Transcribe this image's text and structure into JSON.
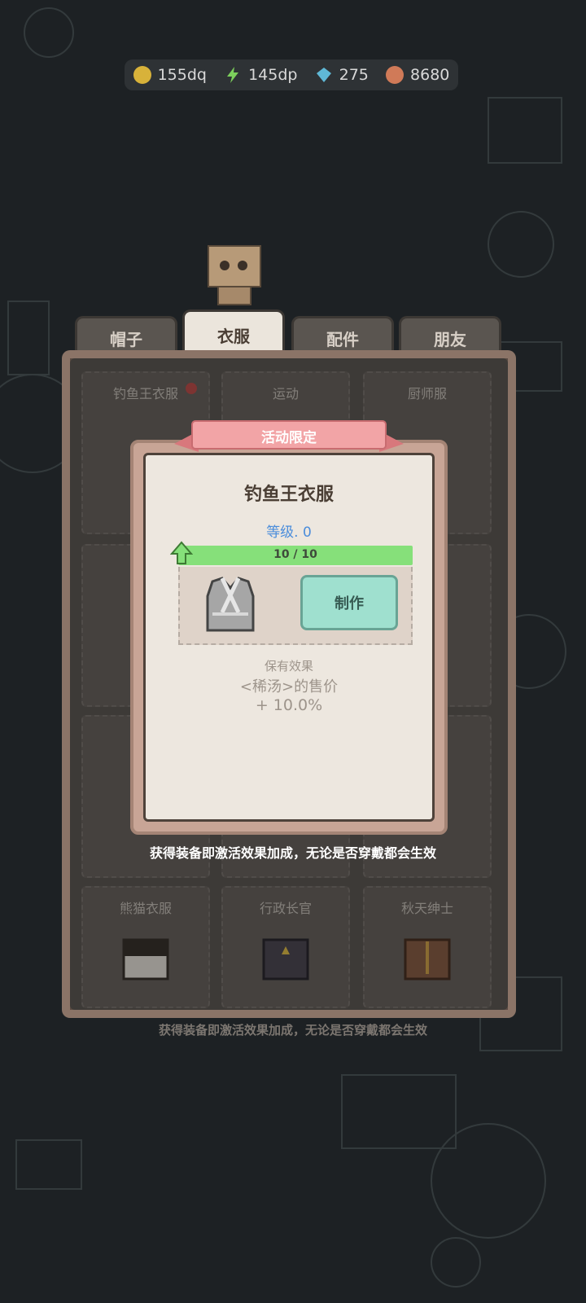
{
  "currencies": [
    {
      "icon": "gold-coin-icon",
      "value": "155dq",
      "color": "#d8b23a"
    },
    {
      "icon": "lightning-icon",
      "value": "145dp",
      "color": "#7ccf5c"
    },
    {
      "icon": "blue-gem-icon",
      "value": "275",
      "color": "#5fb8d6"
    },
    {
      "icon": "meat-icon",
      "value": "8680",
      "color": "#d07a58"
    }
  ],
  "tabs": [
    {
      "label": "帽子"
    },
    {
      "label": "衣服",
      "active": true
    },
    {
      "label": "配件"
    },
    {
      "label": "朋友"
    }
  ],
  "grid": {
    "items": [
      {
        "name": "钓鱼王衣服"
      },
      {
        "name": "运动"
      },
      {
        "name": "厨师服"
      },
      {
        "name": "熊猫衣服"
      },
      {
        "name": "行政长官"
      },
      {
        "name": "秋天绅士"
      }
    ]
  },
  "footer_note": "获得装备即激活效果加成，无论是否穿戴都会生效",
  "modal": {
    "ribbon": "活动限定",
    "title": "钓鱼王衣服",
    "level": "等级. 0",
    "progress": {
      "text": "10 / 10",
      "fraction": 1.0
    },
    "make_button": "制作",
    "effect_head": "保有效果",
    "effect_line": "<稀汤>的售价",
    "effect_value": "+ 10.0%",
    "note": "获得装备即激活效果加成，无论是否穿戴都会生效"
  },
  "colors": {
    "accent_green": "#86e07a",
    "button_teal": "#9fe0cf",
    "ribbon_pink": "#f2a4a6"
  }
}
